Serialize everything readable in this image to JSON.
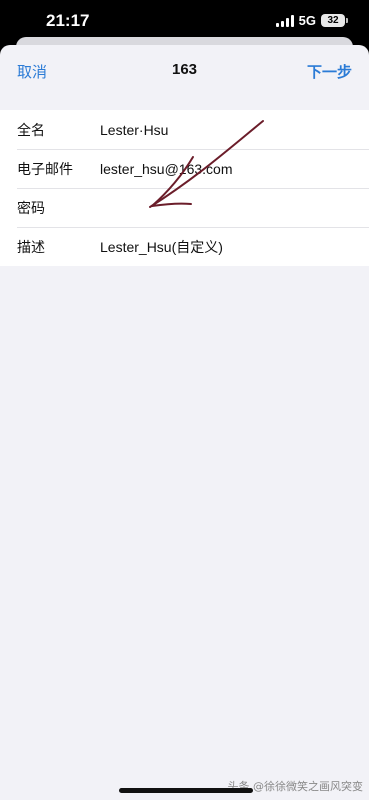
{
  "status_bar": {
    "time": "21:17",
    "network": "5G",
    "battery": "32",
    "icons": [
      "signal-icon",
      "battery-icon"
    ]
  },
  "nav": {
    "cancel_label": "取消",
    "title": "163",
    "next_label": "下一步"
  },
  "form": {
    "rows": [
      {
        "label": "全名",
        "value": "Lester·Hsu"
      },
      {
        "label": "电子邮件",
        "value": "lester_hsu@163.com"
      },
      {
        "label": "密码",
        "value": ""
      },
      {
        "label": "描述",
        "value": "Lester_Hsu(自定义)"
      }
    ]
  },
  "watermark": "头条 @徐徐微笑之画风突变",
  "colors": {
    "accent": "#2b7bd6",
    "sheet_background": "#f2f2f7",
    "annotation": "#6b1d2a"
  }
}
